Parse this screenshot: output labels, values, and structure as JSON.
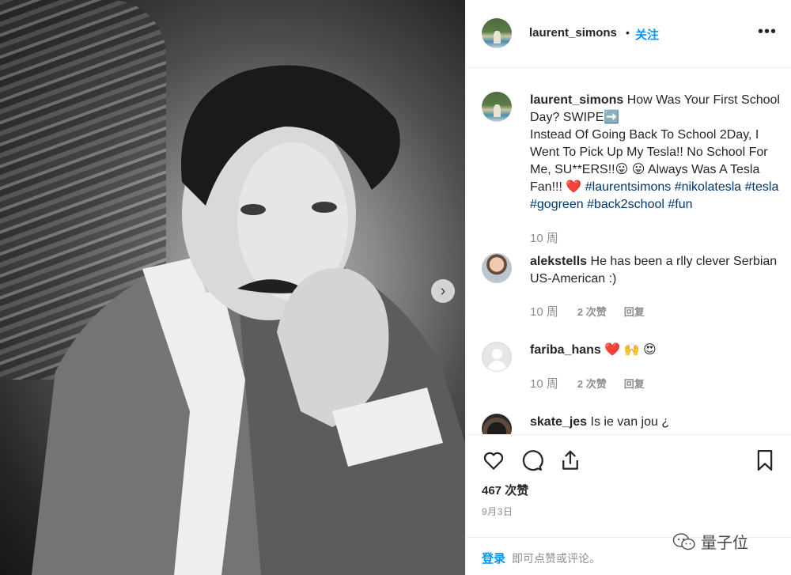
{
  "post": {
    "username": "laurent_simons",
    "separator": "•",
    "follow_label": "关注",
    "more_label": "•••",
    "next_label": "›"
  },
  "caption": {
    "username": "laurent_simons",
    "text_a": " How Was Your First School Day? SWIPE",
    "emoji_arrow": "➡️",
    "text_b": "Instead Of Going Back To School 2Day, I Went To Pick Up My Tesla!! No School For Me, SU**ERS!!",
    "emoji_tongue1": "😛",
    "emoji_tongue2": "😛",
    "text_c": "  Always Was A Tesla Fan!!! ",
    "emoji_heart": "❤️",
    "hashtags": [
      "#laurentsimons",
      "#nikolatesla",
      "#tesla",
      "#gogreen",
      "#back2school",
      "#fun"
    ],
    "time": "10 周"
  },
  "comments": [
    {
      "username": "alekstells",
      "text": " He has been a rlly clever Serbian US-American :)",
      "time": "10 周",
      "likes": "2 次赞",
      "reply": "回复"
    },
    {
      "username": "fariba_hans",
      "text": " ❤️ 🙌 😍",
      "time": "10 周",
      "likes": "2 次赞",
      "reply": "回复"
    },
    {
      "username": "skate_jes",
      "text": " Is ie van jou ¿"
    }
  ],
  "stats": {
    "likes": "467 次赞",
    "date": "9月3日"
  },
  "login_bar": {
    "login": "登录",
    "rest": "即可点赞或评论。"
  },
  "watermark": {
    "text": "量子位"
  },
  "colors": {
    "link_blue": "#0095f6",
    "hashtag": "#00376b",
    "muted": "#8e8e8e",
    "text": "#262626"
  }
}
